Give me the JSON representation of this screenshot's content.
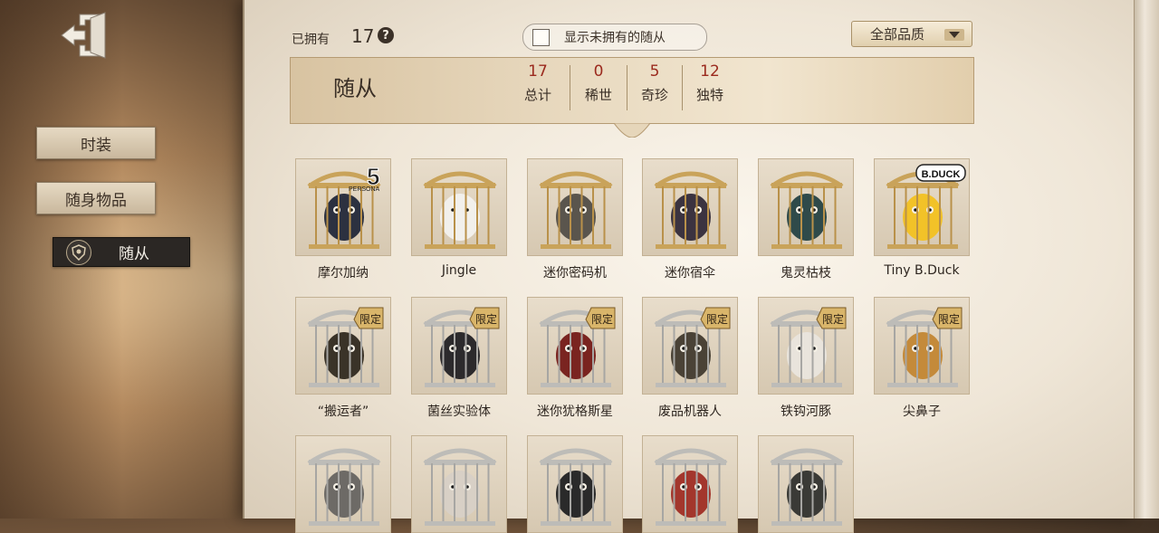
{
  "sidebar": {
    "exit_icon": "exit-door-icon",
    "items": [
      {
        "label": "时装",
        "active": false
      },
      {
        "label": "随身物品",
        "active": false
      },
      {
        "label": "随从",
        "active": true
      }
    ]
  },
  "toolbar": {
    "owned_label": "已拥有",
    "owned_count": "17",
    "help_glyph": "?",
    "show_unowned_label": "显示未拥有的随从",
    "show_unowned_checked": false,
    "quality_filter": "全部品质"
  },
  "header": {
    "title": "随从",
    "stats": [
      {
        "value": "17",
        "label": "总计"
      },
      {
        "value": "0",
        "label": "稀世"
      },
      {
        "value": "5",
        "label": "奇珍"
      },
      {
        "value": "12",
        "label": "独特"
      }
    ]
  },
  "limited_badge": "限定",
  "persona_logo_text": "PERSONA",
  "persona_logo_number": "5",
  "bduck_logo_text": "B.DUCK",
  "items_row1": [
    {
      "name": "摩尔加纳",
      "limited": false,
      "color": "#2c3140"
    },
    {
      "name": "Jingle",
      "limited": false,
      "color": "#f2f0ec"
    },
    {
      "name": "迷你密码机",
      "limited": false,
      "color": "#5a554d"
    },
    {
      "name": "迷你宿伞",
      "limited": false,
      "color": "#3b3340"
    },
    {
      "name": "鬼灵枯枝",
      "limited": false,
      "color": "#2f4a4a"
    },
    {
      "name": "Tiny B.Duck",
      "limited": false,
      "color": "#f2c228"
    }
  ],
  "items_row2": [
    {
      "name": "“搬运者”",
      "limited": true,
      "color": "#3a3328"
    },
    {
      "name": "菌丝实验体",
      "limited": true,
      "color": "#2c2a2c"
    },
    {
      "name": "迷你犹格斯星",
      "limited": true,
      "color": "#7a2420"
    },
    {
      "name": "废品机器人",
      "limited": true,
      "color": "#4a4236"
    },
    {
      "name": "铁钩河豚",
      "limited": true,
      "color": "#e9e4dc"
    },
    {
      "name": "尖鼻子",
      "limited": true,
      "color": "#c48a3a"
    }
  ],
  "items_row3": [
    {
      "color": "#6d6a66"
    },
    {
      "color": "#d8d0c6"
    },
    {
      "color": "#2a2a2a"
    },
    {
      "color": "#a3362c"
    },
    {
      "color": "#3a3a36"
    }
  ]
}
